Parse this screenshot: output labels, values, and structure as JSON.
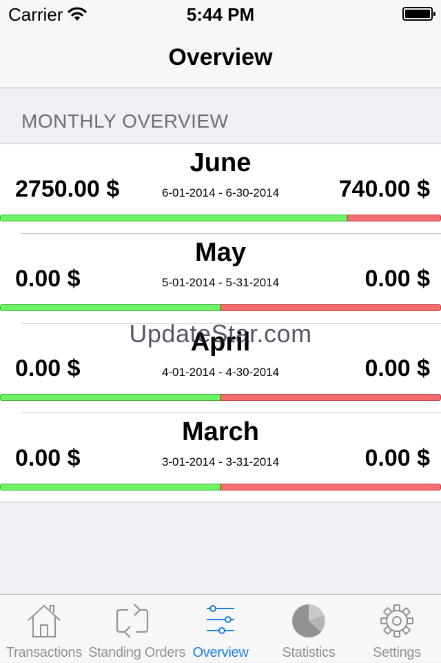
{
  "status_bar": {
    "carrier": "Carrier",
    "time": "5:44 PM"
  },
  "nav": {
    "title": "Overview"
  },
  "section": {
    "header": "MONTHLY OVERVIEW"
  },
  "months": [
    {
      "name": "June",
      "income": "2750.00 $",
      "range": "6-01-2014 - 6-30-2014",
      "expense": "740.00 $",
      "income_share": 0.788
    },
    {
      "name": "May",
      "income": "0.00 $",
      "range": "5-01-2014 - 5-31-2014",
      "expense": "0.00 $",
      "income_share": 0.5
    },
    {
      "name": "April",
      "income": "0.00 $",
      "range": "4-01-2014 - 4-30-2014",
      "expense": "0.00 $",
      "income_share": 0.5
    },
    {
      "name": "March",
      "income": "0.00 $",
      "range": "3-01-2014 - 3-31-2014",
      "expense": "0.00 $",
      "income_share": 0.5
    }
  ],
  "watermark": "UpdateStar.com",
  "tabs": [
    {
      "label": "Transactions",
      "icon": "house-icon"
    },
    {
      "label": "Standing Orders",
      "icon": "repeat-icon"
    },
    {
      "label": "Overview",
      "icon": "sliders-icon",
      "active": true
    },
    {
      "label": "Statistics",
      "icon": "pie-chart-icon"
    },
    {
      "label": "Settings",
      "icon": "gear-icon"
    }
  ],
  "colors": {
    "accent": "#1a7ee0",
    "income_bar": "#6ef265",
    "expense_bar": "#f26d6d",
    "inactive_tab": "#929292"
  }
}
